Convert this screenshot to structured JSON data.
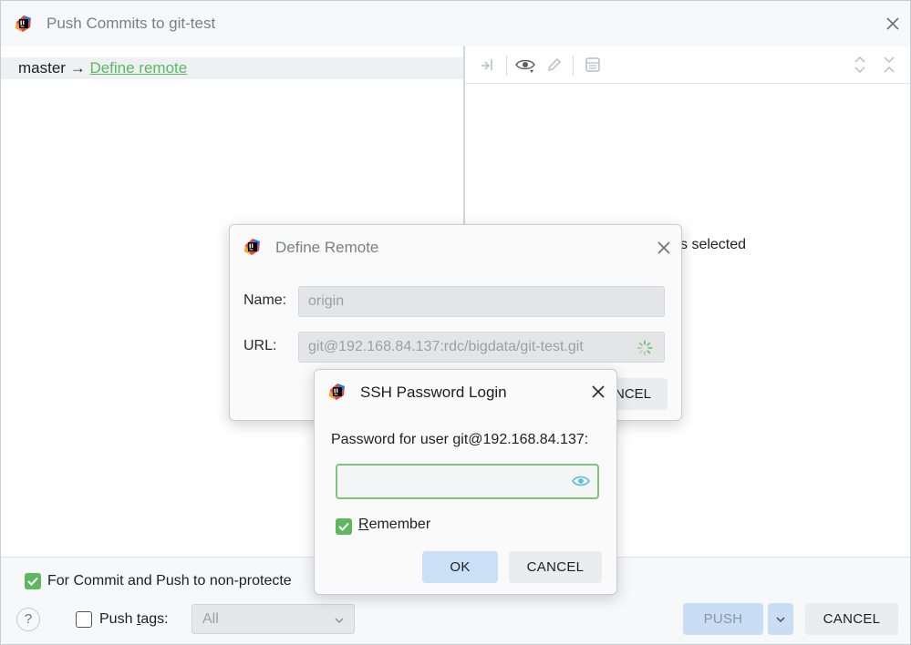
{
  "main_window": {
    "title": "Push Commits to git-test",
    "branch": {
      "local": "master",
      "arrow": "→",
      "remote_link": "Define remote"
    },
    "commits_status": "its selected",
    "options": {
      "commit_push_label": "For Commit and Push to non-protecte",
      "commit_push_checked": true,
      "push_tags_label_pre": "Push ",
      "push_tags_label_mnemonic": "t",
      "push_tags_label_post": "ags:",
      "push_tags_checked": false,
      "push_tags_select_value": "All"
    },
    "buttons": {
      "help": "?",
      "push": "PUSH",
      "cancel": "CANCEL"
    }
  },
  "define_remote": {
    "title": "Define Remote",
    "name_label": "Name:",
    "name_value": "origin",
    "url_label": "URL:",
    "url_value": "git@192.168.84.137:rdc/bigdata/git-test.git",
    "cancel_partial": "NCEL"
  },
  "ssh_login": {
    "title": "SSH Password Login",
    "prompt": "Password for user git@192.168.84.137:",
    "password_value": "",
    "remember_mnemonic": "R",
    "remember_rest": "emember",
    "remember_checked": true,
    "ok": "OK",
    "cancel": "CANCEL"
  },
  "icons": {
    "app_logo": "intellij-logo-icon",
    "close": "close-icon",
    "toolbar": [
      "collapse-arrow-icon",
      "eye-icon",
      "edit-pencil-icon",
      "commit-details-icon",
      "expand-all-icon",
      "collapse-all-icon"
    ],
    "spinner": "loading-spinner-icon",
    "eye_toggle": "show-password-icon",
    "dropdown": "chevron-down-icon",
    "checkbox": "check-icon"
  },
  "colors": {
    "accent_green": "#5fb85f",
    "focus_border": "#7ec47a",
    "primary_button": "#c9e0f7",
    "secondary_button": "#ebecee"
  }
}
